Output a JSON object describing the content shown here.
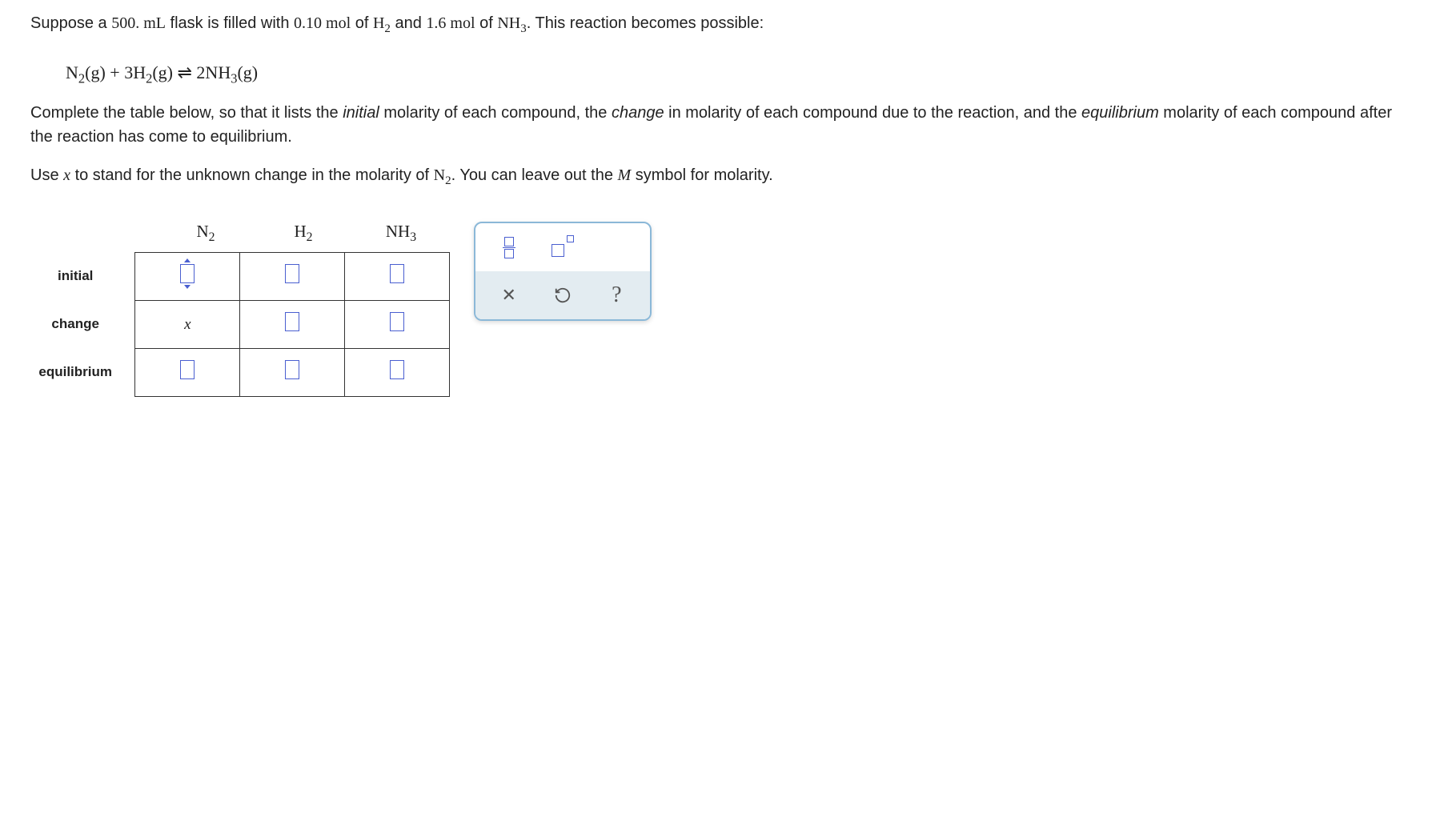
{
  "problem": {
    "line1_pre": "Suppose a ",
    "volume": "500. mL",
    "line1_mid1": " flask is filled with ",
    "mol_h2": "0.10 mol",
    "line1_mid2": " of ",
    "h2": "H",
    "h2_sub": "2",
    "line1_mid3": " and ",
    "mol_nh3": "1.6 mol",
    "line1_mid4": " of ",
    "nh3": "NH",
    "nh3_sub": "3",
    "line1_end": ". This reaction becomes possible:",
    "equation": "N₂(g) + 3H₂(g) ⇌ 2NH₃(g)",
    "line2_pre": "Complete the table below, so that it lists the ",
    "initial_word": "initial",
    "line2_mid1": " molarity of each compound, the ",
    "change_word": "change",
    "line2_mid2": " in molarity of each compound due to the reaction, and the ",
    "equilibrium_word": "equilibrium",
    "line2_end": " molarity of each compound after the reaction has come to equilibrium.",
    "line3_pre": "Use ",
    "x_var": "x",
    "line3_mid1": " to stand for the unknown change in the molarity of ",
    "n2": "N",
    "n2_sub": "2",
    "line3_mid2": ". You can leave out the ",
    "m_var": "M",
    "line3_end": " symbol for molarity."
  },
  "headers": {
    "n2": "N",
    "n2_sub": "2",
    "h2": "H",
    "h2_sub": "2",
    "nh3": "NH",
    "nh3_sub": "3"
  },
  "rows": {
    "initial": "initial",
    "change": "change",
    "equilibrium": "equilibrium",
    "change_n2": "x"
  },
  "chart_data": {
    "type": "table",
    "description": "ICE table for equilibrium reaction",
    "columns": [
      "N2",
      "H2",
      "NH3"
    ],
    "rows": [
      "initial",
      "change",
      "equilibrium"
    ],
    "known_values": {
      "change_N2": "x"
    },
    "given": {
      "volume_mL": 500,
      "mol_H2": 0.1,
      "mol_NH3": 1.6,
      "reaction": "N2(g) + 3H2(g) ⇌ 2NH3(g)"
    }
  }
}
